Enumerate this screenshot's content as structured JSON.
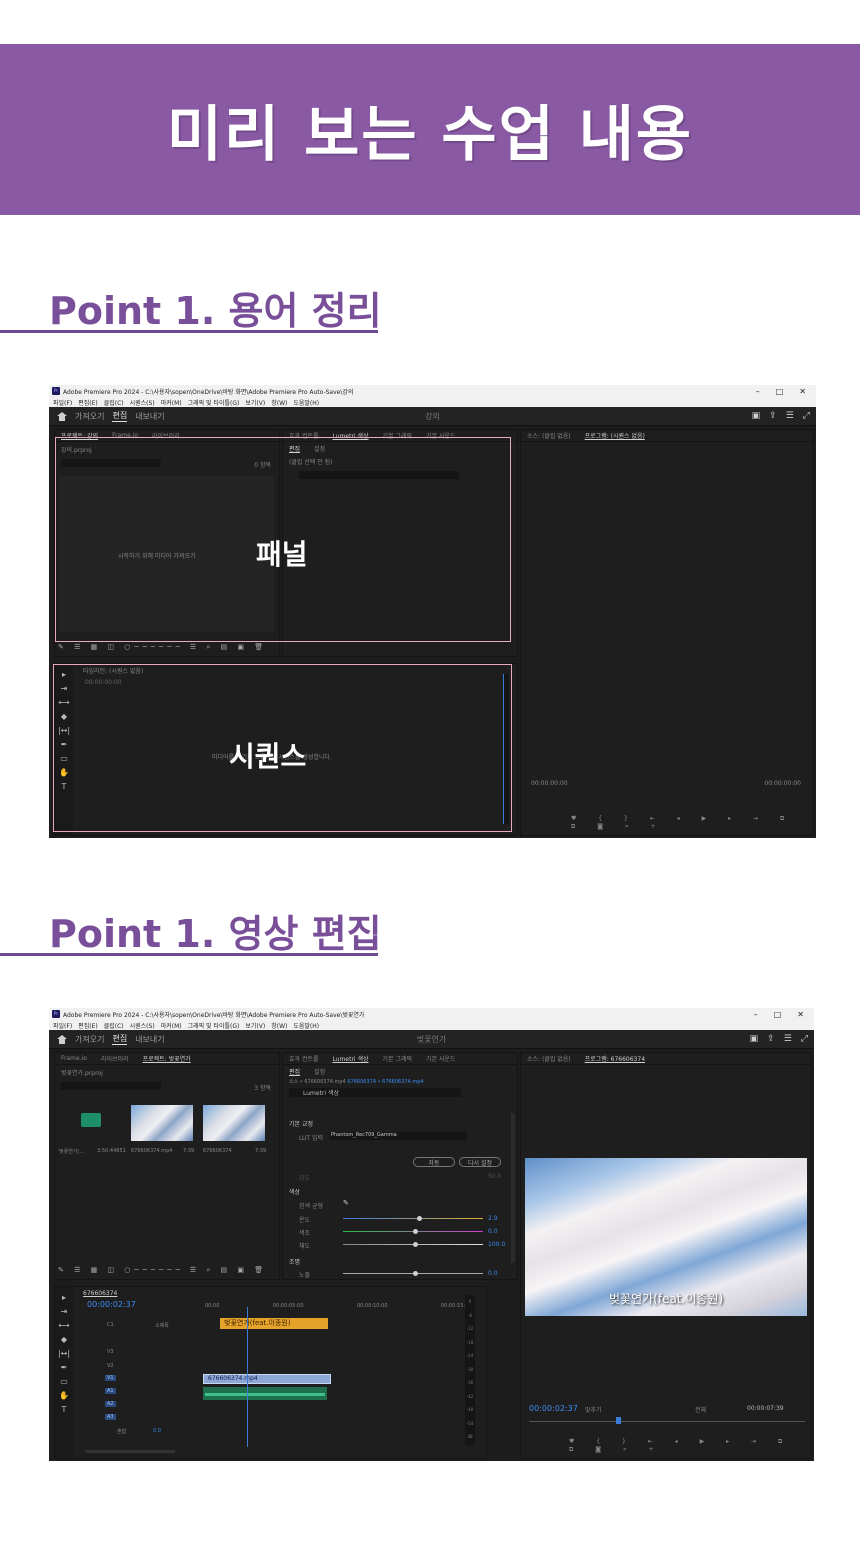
{
  "banner": {
    "title": "미리 보는 수업 내용"
  },
  "section1": {
    "title": "Point 1. 용어 정리"
  },
  "section2": {
    "title": "Point 1. 영상 편집"
  },
  "screen1": {
    "window_title": "Adobe Premiere Pro 2024 - C:\\사용자\\sopen\\OneDrive\\바탕 화면\\Adobe Premiere Pro Auto-Save\\강의",
    "menu": [
      "파일(F)",
      "편집(E)",
      "클립(C)",
      "시퀀스(S)",
      "마커(M)",
      "그래픽 및 타이틀(G)",
      "보기(V)",
      "창(W)",
      "도움말(H)"
    ],
    "workspace_tabs": [
      "가져오기",
      "편집",
      "내보내기"
    ],
    "active_workspace": "편집",
    "project_name": "강의",
    "project_tabs": [
      "프로젝트: 강의",
      "Frame.io",
      "라이브러리"
    ],
    "project_file": "강의.prproj",
    "item_count": "0 항목",
    "import_hint": "시작하기 위해 미디어 가져오기",
    "effect_tabs": [
      "효과 컨트롤",
      "Lumetri 색상",
      "기본 그래픽",
      "기본 사운드"
    ],
    "sub_tabs": [
      "편집",
      "설정"
    ],
    "no_clip": "(클립 선택 안 됨)",
    "source_tab": "소스: (클립 없음)",
    "program_tab": "프로그램: (시퀀스 없음)",
    "timeline_tab": "타임라인: (시퀀스 없음)",
    "timecode": "00:00:00:00",
    "timeline_hint": "미디어를 여기로 드롭하여 시퀀스를 생성합니다.",
    "prog_tc_left": "00:00:00:00",
    "prog_tc_right": "00:00:00:00",
    "label_panel": "패널",
    "label_sequence": "시퀀스"
  },
  "screen2": {
    "window_title": "Adobe Premiere Pro 2024 - C:\\사용자\\sopen\\OneDrive\\바탕 화면\\Adobe Premiere Pro Auto-Save\\벚꽃연가",
    "menu": [
      "파일(F)",
      "편집(E)",
      "클립(C)",
      "시퀀스(S)",
      "마커(M)",
      "그래픽 및 타이틀(G)",
      "보기(V)",
      "창(W)",
      "도움말(H)"
    ],
    "workspace_tabs": [
      "가져오기",
      "편집",
      "내보내기"
    ],
    "project_name": "벚꽃연가",
    "project_tabs": [
      "Frame.io",
      "라이브러리",
      "프로젝트: 벚꽃연가"
    ],
    "project_file": "벚꽃연가.prproj",
    "item_count": "3 항목",
    "bins": [
      {
        "name": "벚꽃연가(...",
        "dur": "3:50:44851"
      },
      {
        "name": "676606374.mp4",
        "dur": "7:39"
      },
      {
        "name": "676606374",
        "dur": "7:39"
      }
    ],
    "effect_tabs": [
      "효과 컨트롤",
      "Lumetri 색상",
      "기본 그래픽",
      "기본 사운드"
    ],
    "sub_tabs": [
      "편집",
      "설정"
    ],
    "source_line": "소스 • 676606374.mp4",
    "source_link": "676606374 • 676606374.mp4",
    "fx_name": "Lumetri 색상",
    "basic_correction": "기본 교정",
    "lut_label": "LUT 입력",
    "lut_value": "Phantom_Rec709_Gamma",
    "auto_btn": "자동",
    "reset_btn": "다시 설정",
    "intensity_label": "강도",
    "intensity_val": "50.0",
    "color_section": "색상",
    "wb_label": "흰색 균형",
    "temp_label": "온도",
    "temp_val": "2.9",
    "tint_label": "색조",
    "tint_val": "0.0",
    "sat_label": "채도",
    "sat_val": "100.0",
    "light_section": "조명",
    "exposure_label": "노출",
    "exposure_val": "0.0",
    "source_tab": "소스: (클립 없음)",
    "program_tab": "프로그램: 676606374",
    "subtitle": "벚꽃연가(feat.이종원)",
    "seq_tab": "676606374",
    "timecode": "00:00:02:37",
    "ruler": [
      "00:00",
      "00:00:05:00",
      "00:00:10:00",
      "00:00:15:00"
    ],
    "tracks": [
      "V3",
      "V2",
      "V1",
      "A1",
      "A2",
      "A3"
    ],
    "track_c1": "C1",
    "subtitle_track": "소제목",
    "master": "혼합",
    "master_val": "0.0",
    "title_clip": "벚꽃연가(feat.이종원)",
    "video_clip": "676606374.mp4",
    "meter_scale": [
      "0",
      "-6",
      "-12",
      "-18",
      "-24",
      "-30",
      "-36",
      "-42",
      "-48",
      "-54",
      "dB"
    ],
    "prog_tc": "00:00:02:37",
    "fit": "맞추기",
    "quality": "전체",
    "duration": "00:00:07:39"
  },
  "colors": {
    "banner": "#8959a3",
    "heading": "#7a4f9a",
    "overlay": "#e9a8c4",
    "timecode": "#3d8bf2",
    "title_clip": "#e6a32a"
  }
}
